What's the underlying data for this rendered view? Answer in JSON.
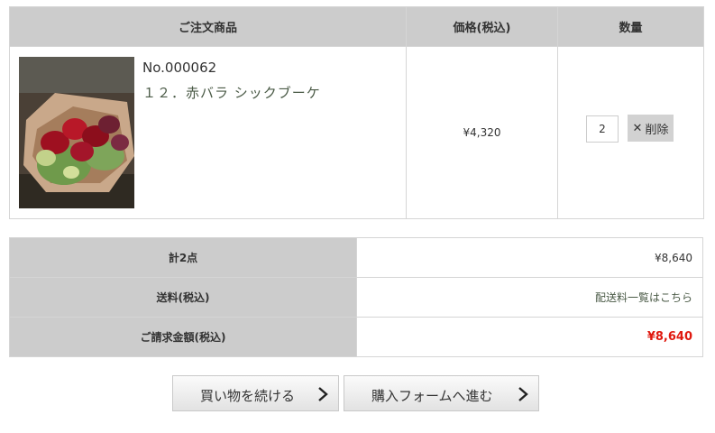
{
  "cart": {
    "headers": {
      "product": "ご注文商品",
      "price": "価格(税込)",
      "quantity": "数量"
    },
    "item": {
      "number": "No.000062",
      "name": "１２．赤バラ シックブーケ",
      "price": "¥4,320",
      "quantity": "2",
      "delete_label": "削除",
      "delete_icon": "close-icon"
    }
  },
  "summary": {
    "count_label": "計2点",
    "count_value": "¥8,640",
    "shipping_label": "送料(税込)",
    "shipping_value": "配送料一覧はこちら",
    "total_label": "ご請求金額(税込)",
    "total_value": "¥8,640",
    "total_color": "#e0190f"
  },
  "buttons": {
    "continue": "買い物を続ける",
    "form": "購入フォームへ進む",
    "chevron_icon": "chevron-right-icon"
  }
}
